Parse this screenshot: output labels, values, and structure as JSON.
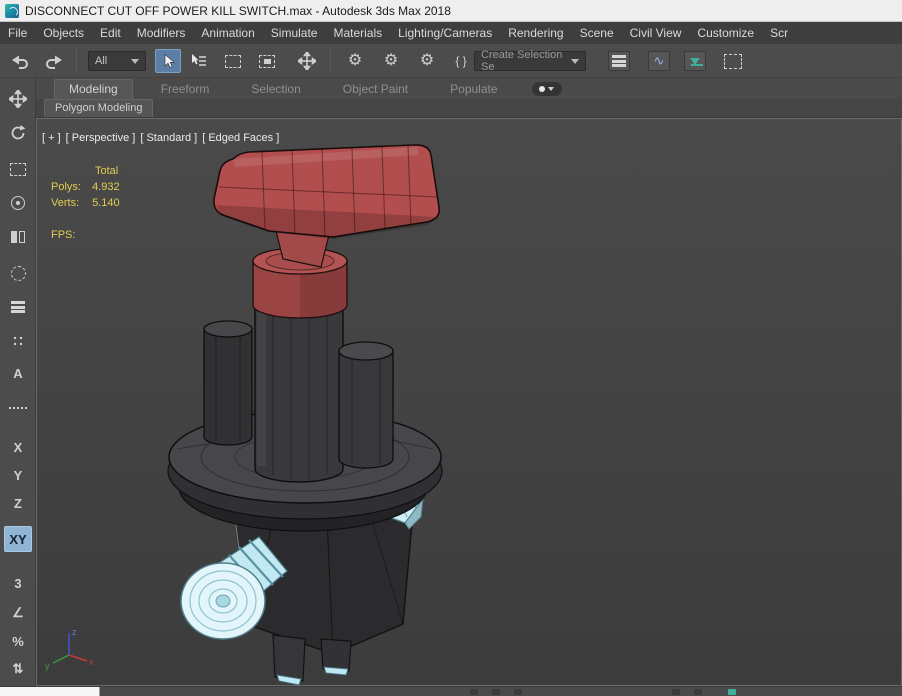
{
  "window": {
    "title": "DISCONNECT CUT OFF POWER KILL SWITCH.max - Autodesk 3ds Max 2018"
  },
  "menu": {
    "items": [
      {
        "label": "File"
      },
      {
        "label": "Objects"
      },
      {
        "label": "Edit"
      },
      {
        "label": "Modifiers"
      },
      {
        "label": "Animation"
      },
      {
        "label": "Simulate"
      },
      {
        "label": "Materials"
      },
      {
        "label": "Lighting/Cameras"
      },
      {
        "label": "Rendering"
      },
      {
        "label": "Scene"
      },
      {
        "label": "Civil View"
      },
      {
        "label": "Customize"
      },
      {
        "label": "Scr"
      }
    ]
  },
  "toolbar": {
    "selection_filter_value": "All",
    "named_selection_value": "Create Selection Se",
    "icon_glyphs": {
      "gear": "⚙",
      "braces": "{ }",
      "curve": "∿"
    }
  },
  "ribbon": {
    "tabs": [
      {
        "label": "Modeling"
      },
      {
        "label": "Freeform"
      },
      {
        "label": "Selection"
      },
      {
        "label": "Object Paint"
      },
      {
        "label": "Populate"
      }
    ],
    "panel_tab": "Polygon Modeling"
  },
  "left_toolbar": {
    "axis_x": "X",
    "axis_y": "Y",
    "axis_z": "Z",
    "axis_xy": "XY",
    "snap_3d": "3",
    "snap_angle": "∠",
    "snap_percent": "%",
    "snap_spinner": "⇅",
    "autogrid": "A"
  },
  "viewport": {
    "labels": {
      "plus": "[ + ]",
      "pov": "[ Perspective ]",
      "shading": "[ Standard ]",
      "edged": "[ Edged Faces ]"
    },
    "stats": {
      "total_label": "Total",
      "polys_label": "Polys:",
      "polys_value": "4.932",
      "verts_label": "Verts:",
      "verts_value": "5.140",
      "fps_label": "FPS:"
    },
    "axis_tripod": {
      "x": "x",
      "y": "y",
      "z": "z"
    },
    "model_name": "power-kill-switch"
  },
  "colors": {
    "stats_text": "#e2cc4f",
    "handle_red": "#b24e4e",
    "body_gray": "#39393c",
    "connector_cyan": "#cfeef6",
    "active_highlight": "#8fb4d4",
    "menubar_bg": "#3e3e3e",
    "toolbar_bg": "#4c4c4c"
  }
}
